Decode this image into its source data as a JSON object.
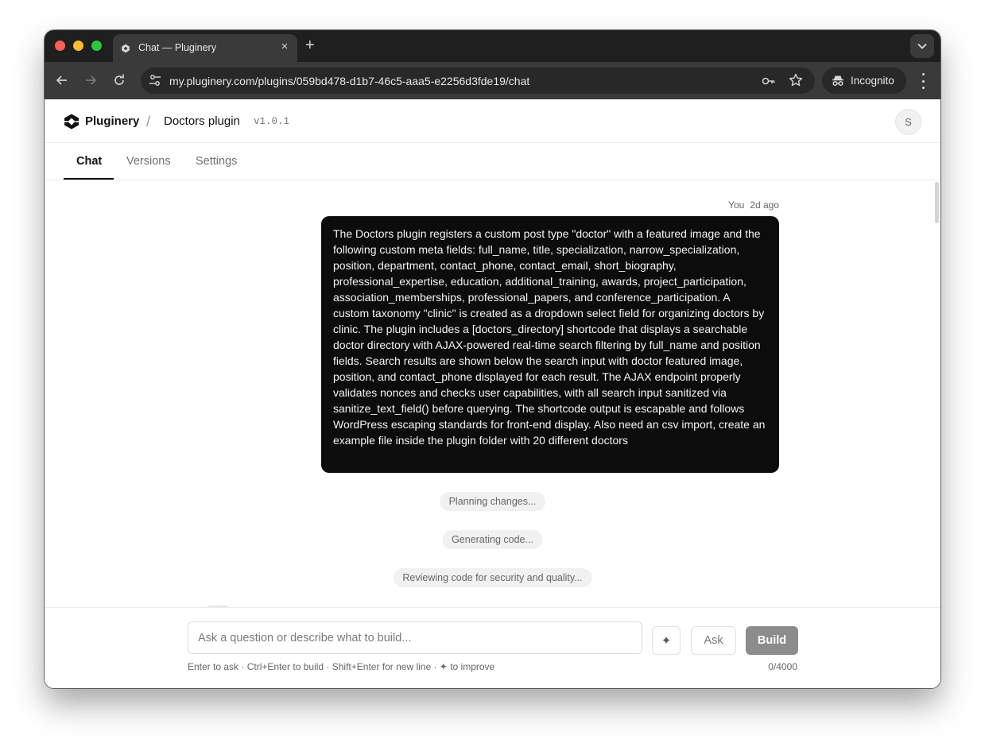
{
  "browser": {
    "tab_title": "Chat — Pluginery",
    "tab_close": "×",
    "new_tab": "+",
    "url": "my.pluginery.com/plugins/059bd478-d1b7-46c5-aaa5-e2256d3fde19/chat",
    "incognito_label": "Incognito"
  },
  "header": {
    "brand": "Pluginery",
    "separator": "/",
    "plugin_name": "Doctors plugin",
    "plugin_version": "v1.0.1",
    "avatar_initial": "S"
  },
  "tabs": {
    "chat": "Chat",
    "versions": "Versions",
    "settings": "Settings"
  },
  "message": {
    "author": "You",
    "time": "2d ago",
    "text": "The Doctors plugin registers a custom post type \"doctor\" with a featured image and the following custom meta fields: full_name, title, specialization, narrow_specialization, position, department, contact_phone, contact_email, short_biography, professional_expertise, education, additional_training, awards, project_participation, association_memberships, professional_papers, and conference_participation. A custom taxonomy \"clinic\" is created as a dropdown select field for organizing doctors by clinic. The plugin includes a [doctors_directory] shortcode that displays a searchable doctor directory with AJAX-powered real-time search filtering by full_name and position fields. Search results are shown below the search input with doctor featured image, position, and contact_phone displayed for each result. The AJAX endpoint properly validates nonces and checks user capabilities, with all search input sanitized via sanitize_text_field() before querying. The shortcode output is escapable and follows WordPress escaping standards for front-end display. Also need an csv import, create an example file inside the plugin folder with 20 different doctors"
  },
  "statuses": [
    "Planning changes...",
    "Generating code...",
    "Reviewing code for security and quality..."
  ],
  "composer": {
    "value": "",
    "placeholder": "Ask a question or describe what to build...",
    "improve_icon": "✦",
    "ask_label": "Ask",
    "build_label": "Build",
    "hint": "Enter to ask · Ctrl+Enter to build · Shift+Enter for new line · ✦ to improve",
    "counter": "0/4000"
  }
}
